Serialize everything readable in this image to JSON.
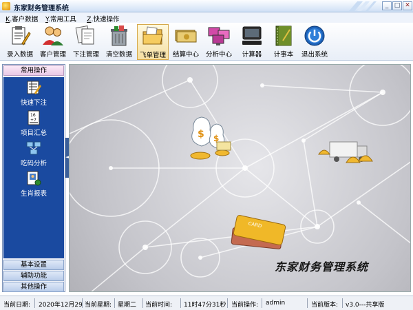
{
  "window": {
    "title": "东家财务管理系统"
  },
  "menu": [
    {
      "key": "K",
      "label": ".客户数据"
    },
    {
      "key": "Y",
      "label": ".常用工具"
    },
    {
      "key": "Z",
      "label": ".快速操作"
    }
  ],
  "toolbar": [
    {
      "label": "录入数据",
      "icon": "clipboard-icon"
    },
    {
      "label": "客户管理",
      "icon": "users-icon"
    },
    {
      "label": "下注管理",
      "icon": "documents-icon"
    },
    {
      "label": "清空数据",
      "icon": "trash-icon"
    },
    {
      "label": "飞单管理",
      "icon": "folder-icon"
    },
    {
      "label": "结算中心",
      "icon": "money-icon"
    },
    {
      "label": "分析中心",
      "icon": "monitors-icon"
    },
    {
      "label": "计算器",
      "icon": "computer-icon"
    },
    {
      "label": "计事本",
      "icon": "notebook-icon"
    },
    {
      "label": "退出系统",
      "icon": "power-icon"
    }
  ],
  "sidebar": {
    "header": "常用操作",
    "items": [
      {
        "label": "快速下注",
        "icon": "pencil-sheet-icon"
      },
      {
        "label": "项目汇总",
        "icon": "calculator-icon"
      },
      {
        "label": "吃码分析",
        "icon": "network-icon"
      },
      {
        "label": "生肖报表",
        "icon": "report-icon"
      }
    ],
    "bottom_buttons": [
      "基本设置",
      "辅助功能",
      "其他操作"
    ],
    "collapse_glyph": "◄"
  },
  "main": {
    "brand": "东家财务管理系统"
  },
  "status": {
    "date_label": "当前日期:",
    "date": "2020年12月29",
    "weekday_label": "当前星期:",
    "weekday": "星期二",
    "time_label": "当前时间:",
    "time": "11时47分31秒",
    "operator_label": "当前操作:",
    "operator": "admin",
    "version_label": "当前版本:",
    "version": "v3.0---共享版"
  },
  "colors": {
    "sidebar_panel": "#1a4aa0",
    "accent": "#d5a84a"
  }
}
